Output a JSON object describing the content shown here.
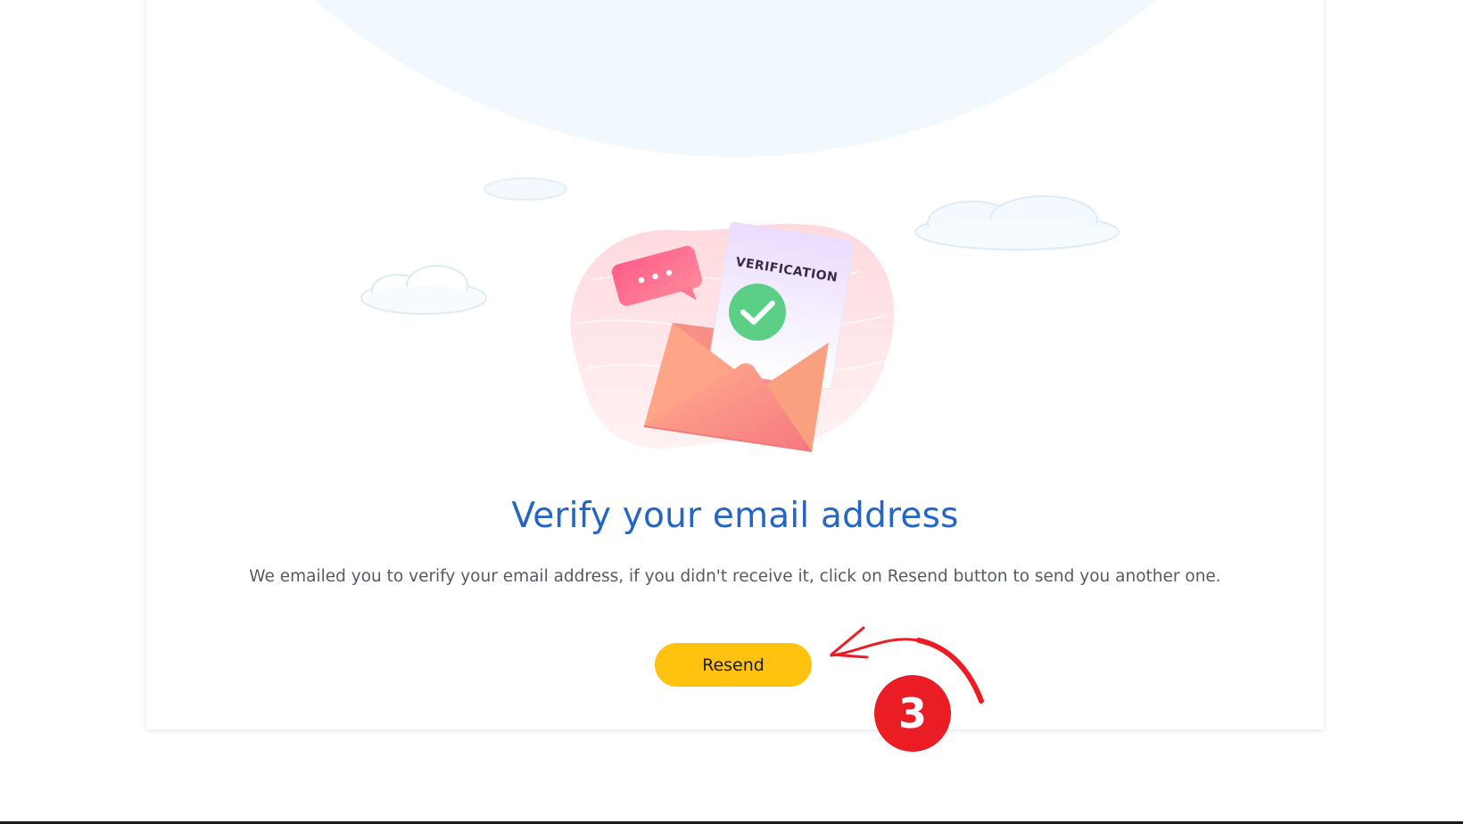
{
  "verify": {
    "illustration_text": "VERIFICATION",
    "title": "Verify your email address",
    "description": "We emailed you to verify your email address, if you didn't receive it, click on Resend button to send you another one.",
    "resend_label": "Resend"
  },
  "annotation": {
    "step_number": "3"
  },
  "colors": {
    "title": "#2566c4",
    "button": "#ffc20e",
    "badge": "#ea1c24",
    "sky": "#f1f8fe"
  }
}
